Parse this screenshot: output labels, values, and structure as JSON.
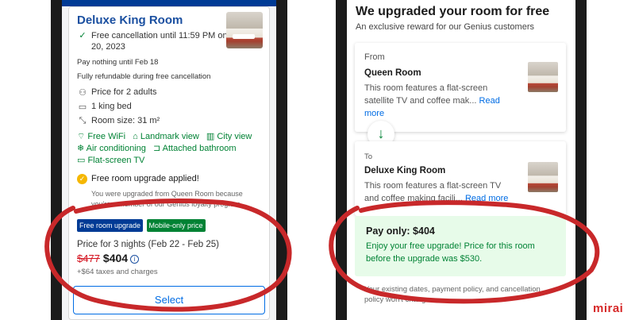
{
  "left": {
    "room_title": "Deluxe King Room",
    "free_cancel": "Free cancellation until 11:59 PM on Feb 20, 2023",
    "pay_nothing": "Pay nothing until Feb 18",
    "refundable": "Fully refundable during free cancellation",
    "price_for": "Price for 2 adults",
    "bed": "1 king bed",
    "size": "Room size: 31 m²",
    "amenities": [
      "Free WiFi",
      "Landmark view",
      "City view",
      "Air conditioning",
      "Attached bathroom",
      "Flat-screen TV"
    ],
    "upgrade_applied": "Free room upgrade applied!",
    "upgrade_note": "You were upgraded from Queen Room because you're a member of our Genius loyalty program.",
    "badge_upgrade": "Free room upgrade",
    "badge_mobile": "Mobile-only price",
    "price_nights": "Price for 3 nights (Feb 22 - Feb 25)",
    "price_old": "$477",
    "price_new": "$404",
    "taxes": "+$64 taxes and charges",
    "select_label": "Select"
  },
  "right": {
    "title": "We upgraded your room for free",
    "subtitle": "An exclusive reward for our Genius customers",
    "from_label": "From",
    "from_room": "Queen Room",
    "from_desc": "This room features a flat-screen satellite TV and coffee mak...",
    "read_more": "Read more",
    "to_label": "To",
    "to_room": "Deluxe King Room",
    "to_desc": "This room features a flat-screen TV and coffee making facili...",
    "pay_only": "Pay only: $404",
    "pay_text": "Enjoy your free upgrade! Price for this room before the upgrade was $530.",
    "footer": "Your existing dates, payment policy, and cancellation policy won't change."
  },
  "brand": "mirai",
  "colors": {
    "booking_blue": "#003b95",
    "link_blue": "#006ce4",
    "green": "#008234",
    "red": "#d62828",
    "genius_badge": "#003b95",
    "mobile_badge": "#008234"
  }
}
